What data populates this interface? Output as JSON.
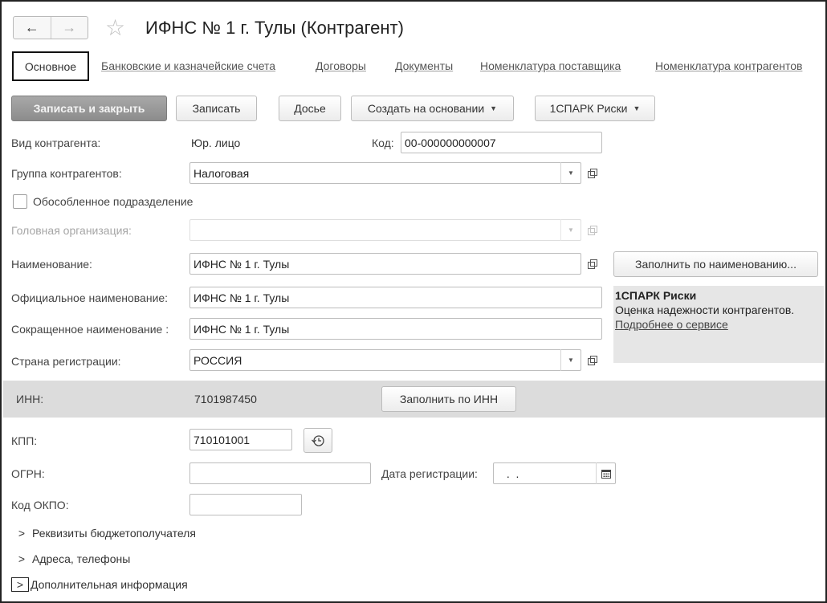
{
  "window": {
    "title": "ИФНС № 1 г. Тулы (Контрагент)"
  },
  "nav": {
    "back_glyph": "←",
    "forward_glyph": "→",
    "star_glyph": "☆"
  },
  "tabs": [
    {
      "label": "Основное",
      "active": true
    },
    {
      "label": "Банковские и казначейские счета"
    },
    {
      "label": "Договоры"
    },
    {
      "label": "Документы"
    },
    {
      "label": "Номенклатура поставщика"
    },
    {
      "label": "Номенклатура контрагентов"
    }
  ],
  "toolbar": {
    "save_close": "Записать и закрыть",
    "save": "Записать",
    "dossier": "Досье",
    "create_based": "Создать на основании",
    "spark": "1СПАРК Риски"
  },
  "form": {
    "kind_label": "Вид контрагента:",
    "kind_value": "Юр. лицо",
    "code_label": "Код:",
    "code_value": "00-000000000007",
    "group_label": "Группа контрагентов:",
    "group_value": "Налоговая",
    "separate_label": "Обособленное подразделение",
    "separate_checked": false,
    "head_org_label": "Головная организация:",
    "head_org_value": "",
    "name_label": "Наименование:",
    "name_value": "ИФНС № 1 г. Тулы",
    "fill_by_name": "Заполнить по наименованию...",
    "official_label": "Официальное наименование:",
    "official_value": "ИФНС № 1 г. Тулы",
    "short_label": "Сокращенное наименование :",
    "short_value": "ИФНС № 1 г. Тулы",
    "country_label": "Страна регистрации:",
    "country_value": "РОССИЯ",
    "inn_label": "ИНН:",
    "inn_value": "7101987450",
    "fill_by_inn": "Заполнить по ИНН",
    "kpp_label": "КПП:",
    "kpp_value": "710101001",
    "ogrn_label": "ОГРН:",
    "ogrn_value": "",
    "reg_date_label": "Дата регистрации:",
    "reg_date_value": " .  .",
    "okpo_label": "Код ОКПО:",
    "okpo_value": ""
  },
  "spark_panel": {
    "title": "1СПАРК Риски",
    "description": "Оценка надежности контрагентов.",
    "link": "Подробнее о сервисе"
  },
  "groups": [
    {
      "label": "Реквизиты бюджетополучателя"
    },
    {
      "label": "Адреса, телефоны"
    },
    {
      "label": "Дополнительная информация"
    }
  ],
  "icons": {
    "dropdown": "▼",
    "chevron": ">"
  }
}
